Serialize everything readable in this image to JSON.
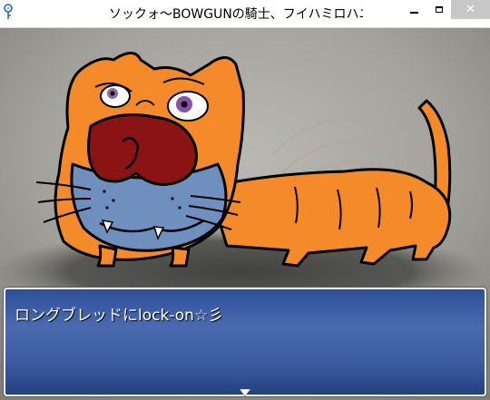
{
  "window": {
    "title": "ソックォ～BOWGUNの騎士、フイハミロハニ",
    "controls": {
      "minimize_icon": "minimize-icon",
      "maximize_icon": "maximize-icon",
      "close_icon": "close-icon",
      "close_glyph": "✕"
    }
  },
  "battle": {
    "enemy_icon": "orange-cat-dog-enemy",
    "message": "ロングブレッドにlock-on☆彡",
    "continue_icon": "continue-arrow-icon"
  },
  "colors": {
    "enemy_body": "#f58a2a",
    "enemy_nose": "#8a1414",
    "enemy_muzzle": "#6f8fbf",
    "message_window": "#3c5ba1",
    "close_button": "#c7c7c7"
  }
}
